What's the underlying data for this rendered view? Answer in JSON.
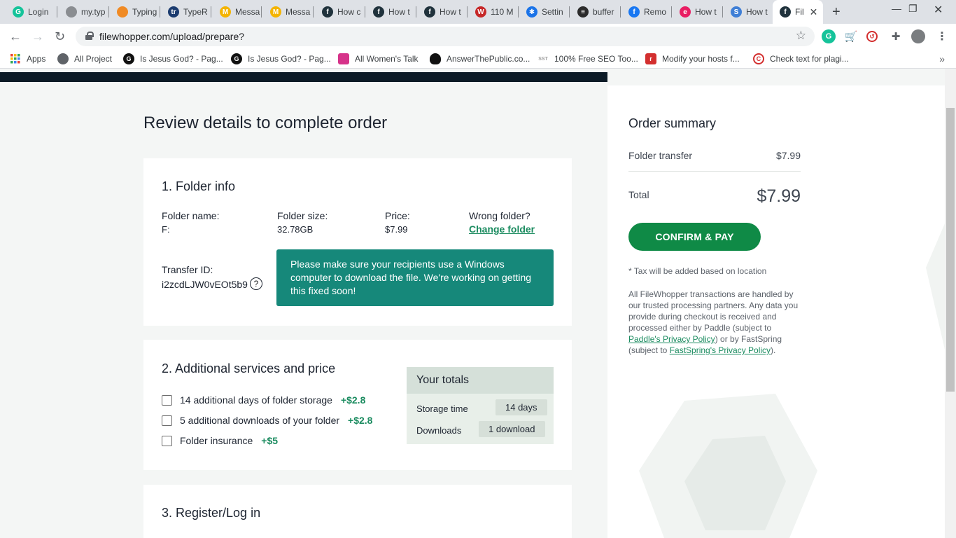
{
  "browser": {
    "tabs": [
      {
        "label": "Login",
        "icon": "grammarly-icon",
        "color": "#15c39a",
        "glyph": "G"
      },
      {
        "label": "my.typ",
        "icon": "globe-icon",
        "color": "#8a8d91",
        "glyph": ""
      },
      {
        "label": "Typing",
        "icon": "typing-icon",
        "color": "#f08a24",
        "glyph": ""
      },
      {
        "label": "TypeR",
        "icon": "tr-icon",
        "color": "#1b3b6f",
        "glyph": "tr"
      },
      {
        "label": "Messa",
        "icon": "gmail-icon",
        "color": "#f4b400",
        "glyph": "M"
      },
      {
        "label": "Messa",
        "icon": "gmail-icon",
        "color": "#f4b400",
        "glyph": "M"
      },
      {
        "label": "How c",
        "icon": "filewhopper-icon",
        "color": "#20323c",
        "glyph": "f"
      },
      {
        "label": "How t",
        "icon": "filewhopper-icon",
        "color": "#20323c",
        "glyph": "f"
      },
      {
        "label": "How t",
        "icon": "filewhopper-icon",
        "color": "#20323c",
        "glyph": "f"
      },
      {
        "label": "110 M",
        "icon": "wl-icon",
        "color": "#c62828",
        "glyph": "W"
      },
      {
        "label": "Settin",
        "icon": "gear-icon",
        "color": "#1a73e8",
        "glyph": "✱"
      },
      {
        "label": "buffer",
        "icon": "buffer-icon",
        "color": "#2b2b2b",
        "glyph": "≡"
      },
      {
        "label": "Remo",
        "icon": "facebook-icon",
        "color": "#1877f2",
        "glyph": "f"
      },
      {
        "label": "How t",
        "icon": "pink-icon",
        "color": "#e91e63",
        "glyph": "e"
      },
      {
        "label": "How t",
        "icon": "sb-icon",
        "color": "#3f7fd6",
        "glyph": "S"
      },
      {
        "label": "Fil",
        "icon": "filewhopper-icon",
        "color": "#20323c",
        "glyph": "f",
        "active": true
      }
    ],
    "url": "filewhopper.com/upload/prepare?",
    "bookmarks": [
      {
        "label": "Apps",
        "icon": "apps-grid-icon",
        "color": "#ea4335"
      },
      {
        "label": "All Project",
        "icon": "globe-icon",
        "color": "#5f6368"
      },
      {
        "label": "Is Jesus God? - Pag...",
        "icon": "g-icon",
        "color": "#111111"
      },
      {
        "label": "Is Jesus God? - Pag...",
        "icon": "g-icon",
        "color": "#111111"
      },
      {
        "label": "All Women's Talk",
        "icon": "awt-icon",
        "color": "#d6338a"
      },
      {
        "label": "AnswerThePublic.co...",
        "icon": "atp-icon",
        "color": "#111111"
      },
      {
        "label": "100% Free SEO Too...",
        "icon": "sst-icon",
        "color": "#9e9e9e"
      },
      {
        "label": "Modify your hosts f...",
        "icon": "r-icon",
        "color": "#d32f2f"
      },
      {
        "label": "Check text for plagi...",
        "icon": "copyright-icon",
        "color": "#d32f2f"
      }
    ]
  },
  "page": {
    "title": "Review details to complete order",
    "folder_info": {
      "heading": "1. Folder info",
      "name_label": "Folder name:",
      "name_value": "F:",
      "size_label": "Folder size:",
      "size_value": "32.78GB",
      "price_label": "Price:",
      "price_value": "$7.99",
      "wrong_label": "Wrong folder?",
      "change_link": "Change folder",
      "transfer_label": "Transfer ID:",
      "transfer_value": "i2zcdLJW0vEOt5b9",
      "help_glyph": "?",
      "notice": "Please make sure your recipients use a Windows computer to download the file. We're working on getting this fixed soon!"
    },
    "services": {
      "heading": "2. Additional services and price",
      "items": [
        {
          "label": "14 additional days of folder storage",
          "price": "+$2.8"
        },
        {
          "label": "5 additional downloads of your folder",
          "price": "+$2.8"
        },
        {
          "label": "Folder insurance",
          "price": "+$5"
        }
      ],
      "totals": {
        "heading": "Your totals",
        "storage_label": "Storage time",
        "storage_value": "14 days",
        "downloads_label": "Downloads",
        "downloads_value": "1 download"
      }
    },
    "register": {
      "heading": "3. Register/Log in"
    }
  },
  "summary": {
    "title": "Order summary",
    "line_label": "Folder transfer",
    "line_value": "$7.99",
    "total_label": "Total",
    "total_value": "$7.99",
    "confirm_label": "CONFIRM & PAY",
    "tax_note": "* Tax will be added based on location",
    "legal_1": "All FileWhopper transactions are handled by our trusted processing partners. Any data you provide during checkout is received and processed either by Paddle (subject to ",
    "legal_link1": "Paddle's Privacy Policy",
    "legal_2": ") or by FastSpring (subject to ",
    "legal_link2": "FastSpring's Privacy Policy",
    "legal_3": ")."
  },
  "colors": {
    "accent_green": "#0f8a46",
    "notice_teal": "#16887a",
    "nav_dark": "#0c1a26"
  }
}
